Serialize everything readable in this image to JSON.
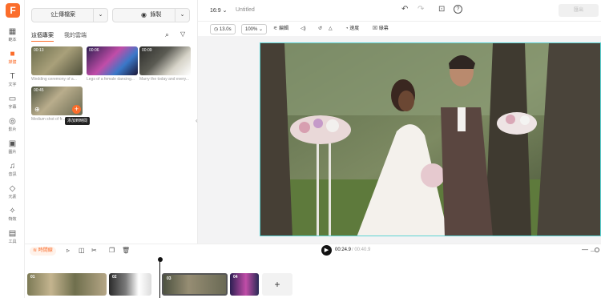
{
  "rail": {
    "items": [
      {
        "label": "範本",
        "icon": "template-icon"
      },
      {
        "label": "媒體",
        "icon": "media-icon"
      },
      {
        "label": "文字",
        "icon": "text-icon"
      },
      {
        "label": "字幕",
        "icon": "subtitle-icon"
      },
      {
        "label": "影片",
        "icon": "video-icon"
      },
      {
        "label": "圖片",
        "icon": "image-icon"
      },
      {
        "label": "音訊",
        "icon": "music-icon"
      },
      {
        "label": "元素",
        "icon": "elements-icon"
      },
      {
        "label": "特效",
        "icon": "effects-icon"
      },
      {
        "label": "工具",
        "icon": "tools-icon"
      }
    ],
    "active_index": 1
  },
  "panel": {
    "upload_label": "上傳檔案",
    "record_label": "錄製",
    "tabs": [
      "這個專案",
      "我的雲端"
    ],
    "media": [
      {
        "duration": "00:13",
        "caption": "Wedding ceremony of a..."
      },
      {
        "duration": "00:06",
        "caption": "Legs of a female dancing..."
      },
      {
        "duration": "00:09",
        "caption": "Marry the today and every..."
      },
      {
        "duration": "00:45",
        "caption": "Medium shot of fr..."
      }
    ],
    "tooltip": "添加到時間"
  },
  "topbar": {
    "ratio": "16:9",
    "title": "Untitled",
    "export_label": "匯出"
  },
  "toolbar": {
    "duration": "13.0s",
    "zoom": "100%",
    "edit": "編輯",
    "speed": "速度",
    "crop": "綠幕"
  },
  "timeline": {
    "label": "時間線",
    "current_time": "00:24.9",
    "total_time": "/ 00:40.9",
    "clips": [
      "01",
      "02",
      "03",
      "04"
    ],
    "add_label": "+"
  },
  "colors": {
    "accent": "#fb6d2b",
    "stage_border": "#5bd3d3"
  }
}
